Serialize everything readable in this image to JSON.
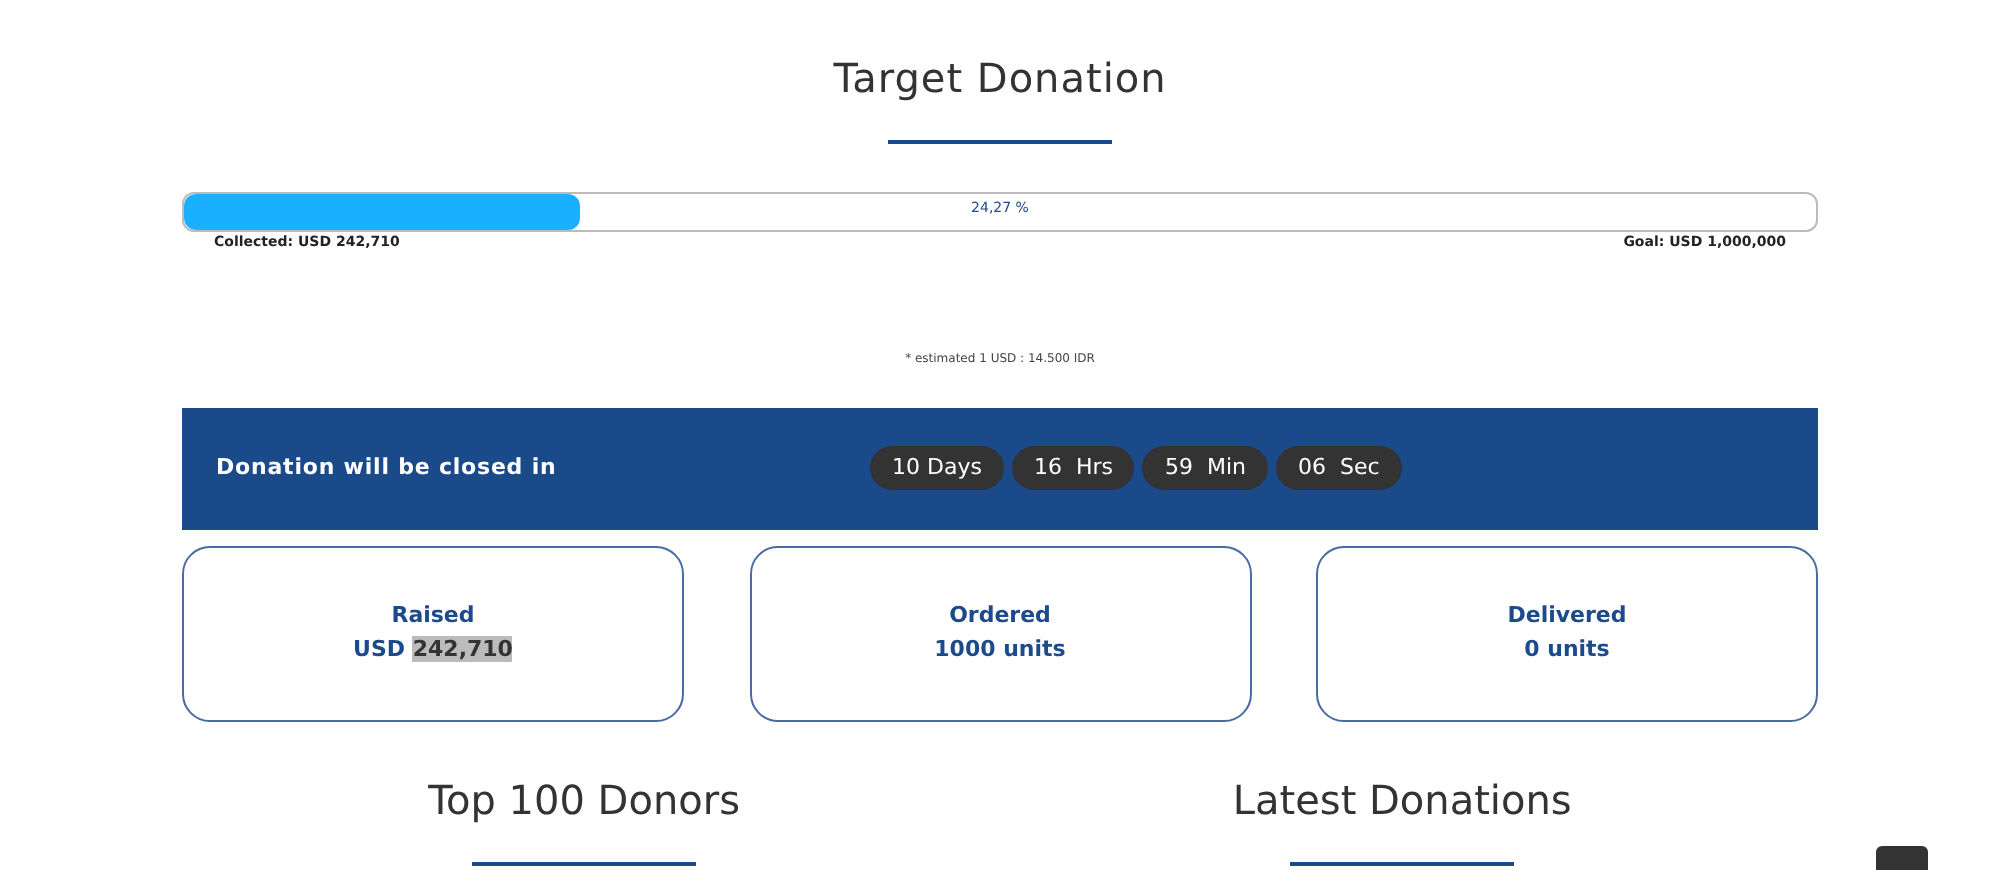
{
  "target": {
    "title": "Target Donation",
    "progress": {
      "level": 0.2427,
      "reading": "24,27 %"
    },
    "collected": "Collected: USD 242,710",
    "goal": "Goal: USD 1,000,000",
    "note": "* estimated 1 USD : 14.500 IDR"
  },
  "countdown": {
    "label": "Donation will be closed in",
    "units": [
      {
        "text": "10 Days"
      },
      {
        "text": "16  Hrs"
      },
      {
        "text": "59  Min"
      },
      {
        "text": "06  Sec"
      }
    ]
  },
  "stats": [
    {
      "label": "Raised",
      "value_parts": [
        {
          "text": "USD ",
          "highlighted": false
        },
        {
          "text": "242,710",
          "highlighted": true
        }
      ]
    },
    {
      "label": "Ordered",
      "value_parts": [
        {
          "text": "1000 units",
          "highlighted": false
        }
      ]
    },
    {
      "label": "Delivered",
      "value_parts": [
        {
          "text": "0 units",
          "highlighted": false
        }
      ]
    }
  ],
  "sections": [
    {
      "title": "Top 100 Donors"
    },
    {
      "title": "Latest Donations"
    }
  ]
}
